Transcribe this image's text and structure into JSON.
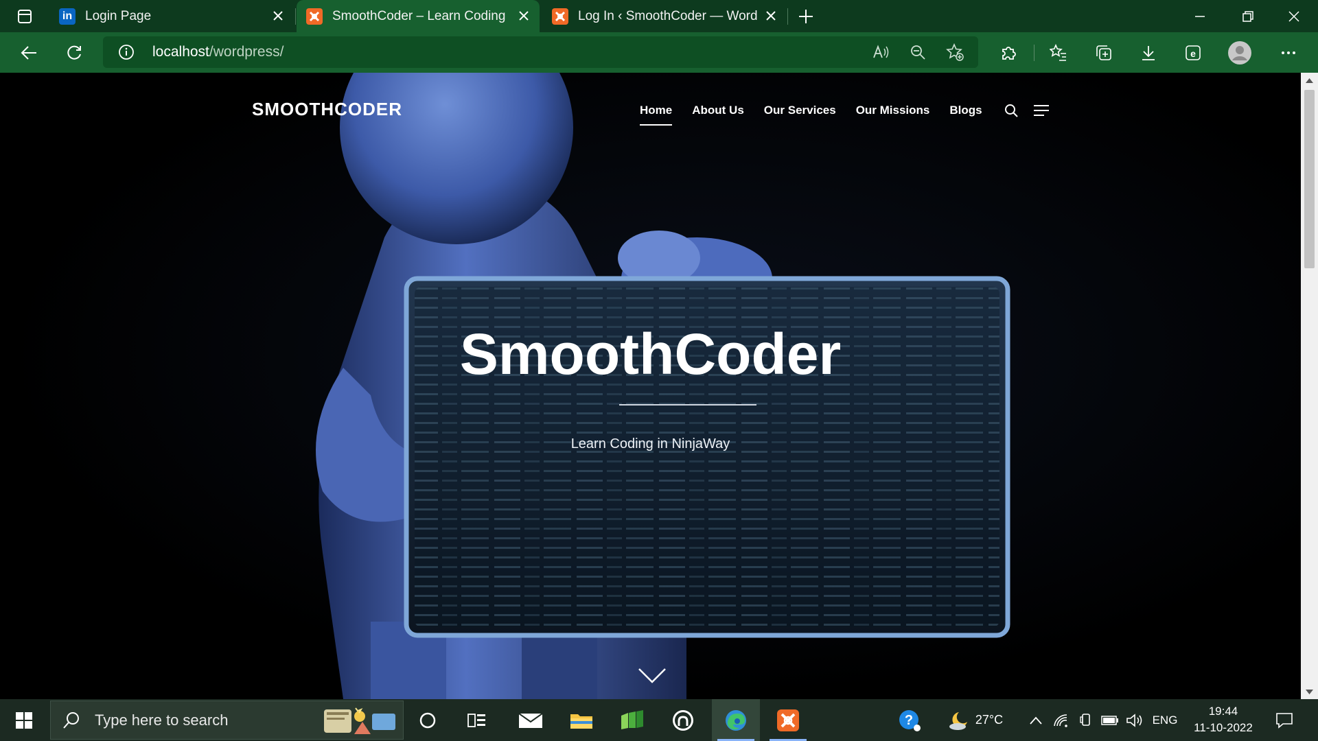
{
  "browser": {
    "tabs": [
      {
        "title": "Login Page",
        "favicon_text": "in",
        "favicon_color": "#0a66c2",
        "active": false
      },
      {
        "title": "SmoothCoder – Learn Coding in",
        "favicon_text": "XA",
        "favicon_color": "#f06a27",
        "active": true
      },
      {
        "title": "Log In ‹ SmoothCoder — WordP",
        "favicon_text": "XA",
        "favicon_color": "#f06a27",
        "active": false
      }
    ],
    "url_host": "localhost",
    "url_path": "/wordpress/"
  },
  "site": {
    "logo": "SMOOTHCODER",
    "nav": [
      "Home",
      "About Us",
      "Our Services",
      "Our Missions",
      "Blogs"
    ],
    "active_nav": "Home",
    "hero_title": "SmoothCoder",
    "hero_subtitle": "Learn Coding in NinjaWay"
  },
  "taskbar": {
    "search_placeholder": "Type here to search",
    "weather_temp": "27°C",
    "language": "ENG",
    "time": "19:44",
    "date": "11-10-2022"
  },
  "colors": {
    "tabstrip": "#0d3a1e",
    "toolbar": "#17602f",
    "accent": "#f06a27",
    "taskbar": "#1c2a22"
  }
}
